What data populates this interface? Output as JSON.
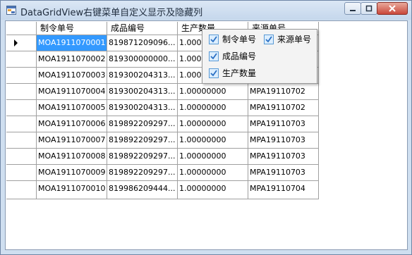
{
  "window": {
    "title": "DataGridView右键菜单自定义显示及隐藏列"
  },
  "grid": {
    "columns": [
      "制令单号",
      "成品编号",
      "生产数量",
      "来源单号"
    ],
    "rows": [
      [
        "MOA1911070001",
        "819871209096...",
        "1.0000",
        ""
      ],
      [
        "MOA1911070002",
        "819300000000...",
        "1.0000",
        ""
      ],
      [
        "MOA1911070003",
        "819300204313...",
        "1.0000",
        ""
      ],
      [
        "MOA1911070004",
        "819300204313...",
        "1.00000000",
        "MPA19110702"
      ],
      [
        "MOA1911070005",
        "819300204313...",
        "1.00000000",
        "MPA19110702"
      ],
      [
        "MOA1911070006",
        "819892209297...",
        "1.00000000",
        "MPA19110703"
      ],
      [
        "MOA1911070007",
        "819892209297...",
        "1.00000000",
        "MPA19110703"
      ],
      [
        "MOA1911070008",
        "819892209297...",
        "1.00000000",
        "MPA19110703"
      ],
      [
        "MOA1911070009",
        "819892209297...",
        "1.00000000",
        "MPA19110703"
      ],
      [
        "MOA1911070010",
        "819986209444...",
        "1.00000000",
        "MPA19110704"
      ]
    ],
    "selected_cell": "MOA1911070001"
  },
  "context_menu": {
    "items": [
      {
        "label": "制令单号",
        "checked": true
      },
      {
        "label": "来源单号",
        "checked": true
      },
      {
        "label": "成品编号",
        "checked": true
      },
      {
        "label": "生产数量",
        "checked": true
      }
    ]
  },
  "colors": {
    "selection": "#3399ff",
    "close_button": "#c9483b",
    "titlebar": "#c5d7ec"
  }
}
